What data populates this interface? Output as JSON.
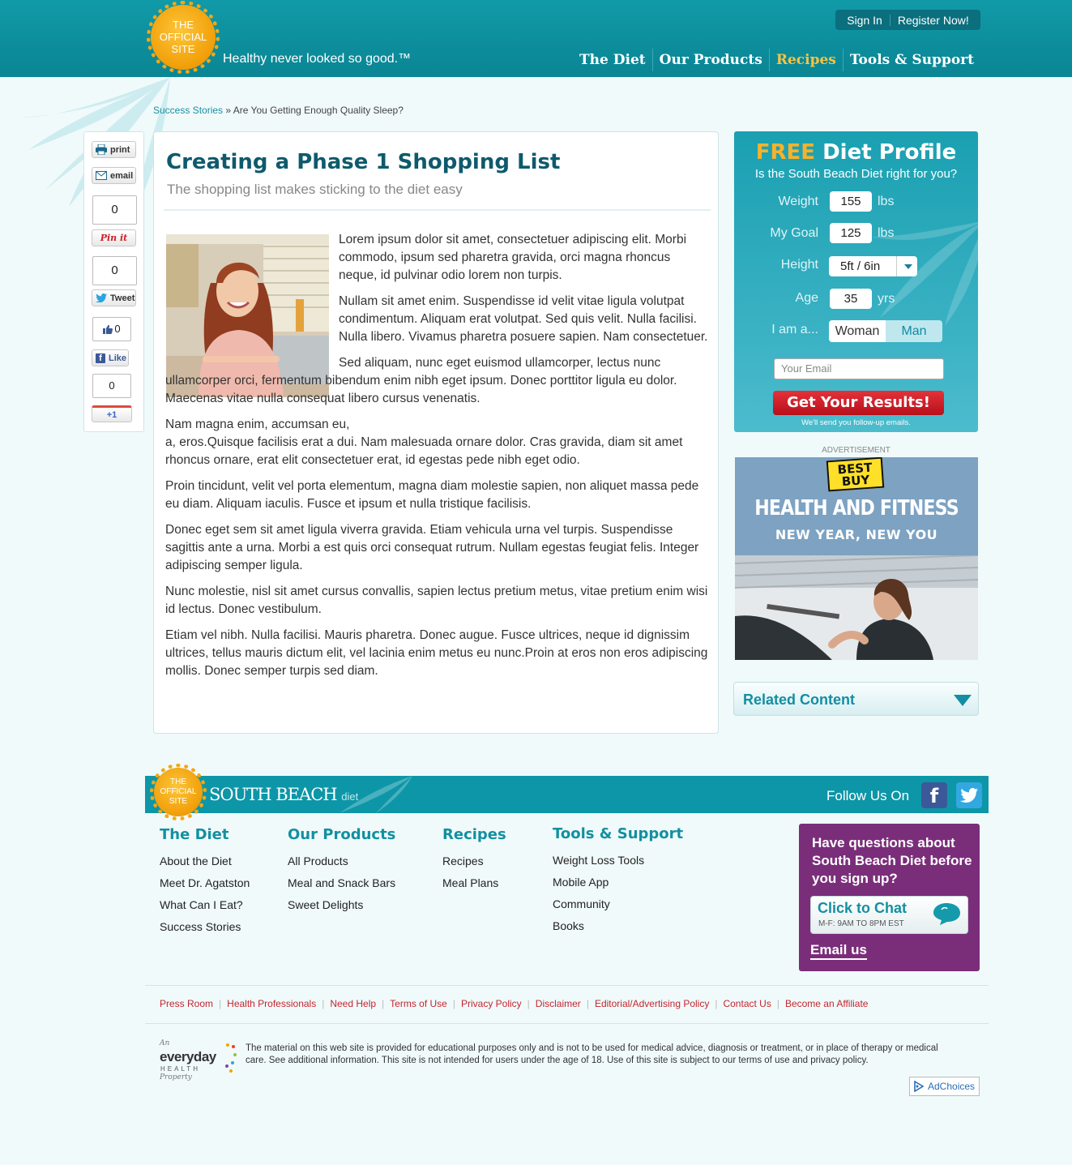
{
  "header": {
    "seal_text": [
      "THE",
      "OFFICIAL",
      "SITE"
    ],
    "tagline": "Healthy never looked so good.™",
    "sign_in": "Sign In",
    "register": "Register Now!",
    "nav": [
      {
        "label": "The Diet",
        "active": false
      },
      {
        "label": "Our Products",
        "active": false
      },
      {
        "label": "Recipes",
        "active": true
      },
      {
        "label": "Tools & Support",
        "active": false
      }
    ]
  },
  "breadcrumb": {
    "link": "Success Stories",
    "separator": "»",
    "current": "Are You Getting Enough Quality Sleep?"
  },
  "social": {
    "print_label": "print",
    "email_label": "email",
    "pinterest_count": "0",
    "pinterest_label": "Pin it",
    "tweet_count": "0",
    "tweet_label": "Tweet",
    "fb_count": "0",
    "fb_label": "Like",
    "gplus_count": "0",
    "gplus_label": "+1"
  },
  "article": {
    "title": "Creating a Phase 1 Shopping List",
    "subtitle": "The shopping list makes sticking to the diet easy",
    "paragraphs": [
      "Lorem ipsum dolor sit amet, consectetuer adipiscing elit. Morbi commodo, ipsum sed pharetra gravida, orci magna rhoncus neque, id pulvinar odio lorem non turpis.",
      "Nullam sit amet enim. Suspendisse id velit vitae ligula volutpat condimentum. Aliquam erat volutpat. Sed quis velit. Nulla facilisi. Nulla libero. Vivamus pharetra posuere sapien. Nam consectetuer.",
      "Sed aliquam, nunc eget euismod ullamcorper, lectus nunc ullamcorper orci, fermentum bibendum enim nibh eget ipsum. Donec porttitor ligula eu dolor. Maecenas vitae nulla consequat libero cursus venenatis.",
      "Nam magna enim, accumsan eu,",
      "a, eros.Quisque facilisis erat a dui. Nam malesuada ornare dolor. Cras gravida, diam sit amet rhoncus ornare, erat elit consectetuer erat, id egestas pede nibh eget odio.",
      "Proin tincidunt, velit vel porta elementum, magna diam molestie sapien, non aliquet massa pede eu diam. Aliquam iaculis. Fusce et ipsum et nulla tristique facilisis.",
      "Donec eget sem sit amet ligula viverra gravida. Etiam vehicula urna vel turpis. Suspendisse sagittis ante a urna. Morbi a est quis orci consequat rutrum. Nullam egestas feugiat felis. Integer adipiscing semper ligula.",
      "Nunc molestie, nisl sit amet cursus convallis, sapien lectus pretium metus, vitae pretium enim wisi id lectus. Donec vestibulum.",
      "Etiam vel nibh. Nulla facilisi. Mauris pharetra. Donec augue. Fusce ultrices, neque id dignissim ultrices, tellus mauris dictum elit, vel lacinia enim metus eu nunc.Proin at eros non eros adipiscing mollis. Donec semper turpis sed diam."
    ]
  },
  "profile": {
    "free": "FREE",
    "title": "Diet Profile",
    "question": "Is the South Beach Diet right for you?",
    "weight_label": "Weight",
    "weight_value": "155",
    "weight_unit": "lbs",
    "goal_label": "My Goal",
    "goal_value": "125",
    "goal_unit": "lbs",
    "height_label": "Height",
    "height_value": "5ft / 6in",
    "age_label": "Age",
    "age_value": "35",
    "age_unit": "yrs",
    "gender_label": "I am a...",
    "woman": "Woman",
    "man": "Man",
    "email_placeholder": "Your Email",
    "submit": "Get Your Results!",
    "followup": "We'll send you follow-up emails."
  },
  "ad": {
    "label": "ADVERTISEMENT",
    "logo": [
      "BEST",
      "BUY"
    ],
    "headline": "HEALTH AND FITNESS",
    "subhead": "NEW YEAR, NEW YOU"
  },
  "related": {
    "label": "Related Content"
  },
  "footer": {
    "seal_text": [
      "THE",
      "OFFICIAL",
      "SITE"
    ],
    "brand": "SOUTH BEACH",
    "brand_small": "diet",
    "follow": "Follow Us On",
    "columns": [
      {
        "title": "The Diet",
        "links": [
          "About the Diet",
          "Meet Dr. Agatston",
          "What Can I Eat?",
          "Success Stories"
        ]
      },
      {
        "title": "Our Products",
        "links": [
          "All Products",
          "Meal and Snack Bars",
          "Sweet Delights"
        ]
      },
      {
        "title": "Recipes",
        "links": [
          "Recipes",
          "Meal Plans"
        ]
      },
      {
        "title": "Tools & Support",
        "links": [
          "Weight Loss Tools",
          "Mobile App",
          "Community",
          "Books"
        ]
      }
    ],
    "chat": {
      "question": "Have questions about South Beach Diet before you sign up?",
      "button": "Click to Chat",
      "hours": "M-F: 9AM TO 8PM EST",
      "email": "Email us"
    },
    "legal_links": [
      "Press Room",
      "Health Professionals",
      "Need Help",
      "Terms of Use",
      "Privacy Policy",
      "Disclaimer",
      "Editorial/Advertising Policy",
      "Contact Us",
      "Become an Affiliate"
    ],
    "everyday": {
      "an": "An",
      "name": "everyday",
      "health": "HEALTH",
      "property": "Property"
    },
    "disclaimer": "The material on this web site is provided for educational purposes only and is not to be used for medical advice, diagnosis or treatment, or in place of therapy or medical care. See additional information. This site is not intended for users under the age of 18. Use of this site is subject to our terms of use and privacy policy.",
    "adchoices": "AdChoices"
  },
  "colors": {
    "header_teal": "#0a8594",
    "accent_gold": "#f7c444",
    "title_teal": "#0e5a6c",
    "submit_red": "#c8161f",
    "chat_purple": "#7a2e7a",
    "legal_red": "#c4262e"
  }
}
